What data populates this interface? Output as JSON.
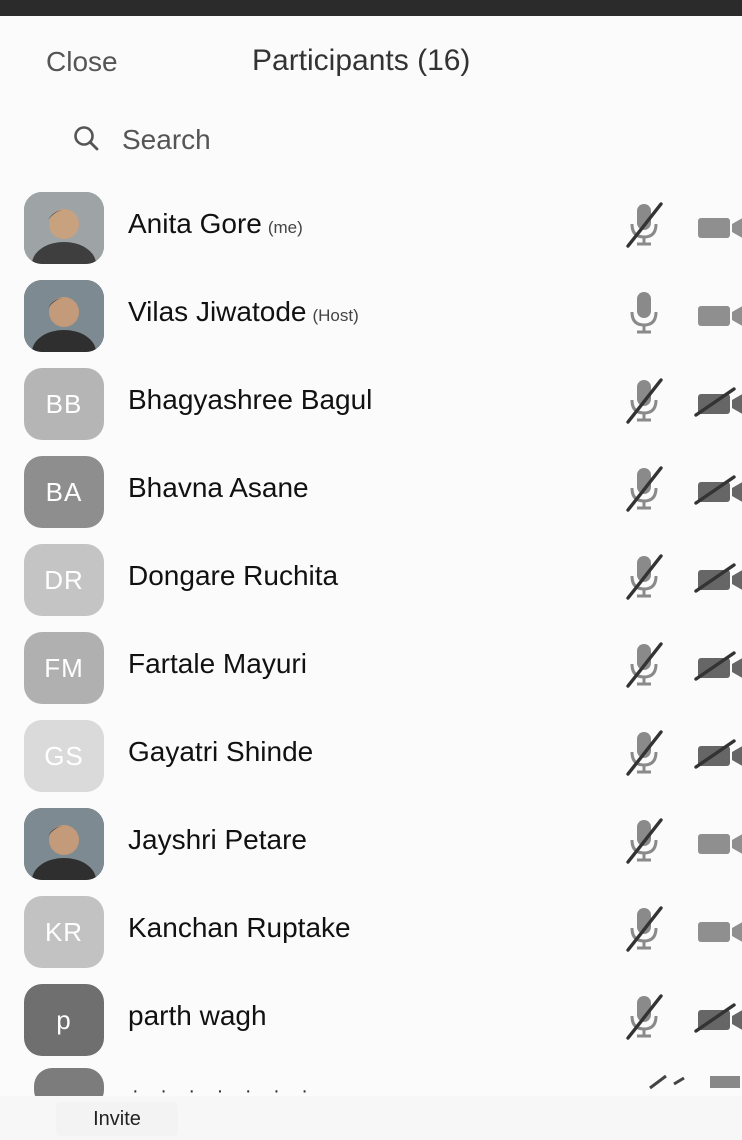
{
  "header": {
    "close_label": "Close",
    "title": "Participants (16)"
  },
  "search": {
    "placeholder": "Search",
    "icon": "search-icon"
  },
  "participants": [
    {
      "name": "Anita Gore",
      "tag": "(me)",
      "avatar": "photo",
      "mic": "muted",
      "video": "on"
    },
    {
      "name": "Vilas Jiwatode",
      "tag": "(Host)",
      "avatar": "photo",
      "mic": "on",
      "video": "on"
    },
    {
      "name": "Bhagyashree Bagul",
      "tag": "",
      "initials": "BB",
      "color": "#b5b5b5",
      "mic": "muted",
      "video": "off"
    },
    {
      "name": "Bhavna Asane",
      "tag": "",
      "initials": "BA",
      "color": "#8e8e8e",
      "mic": "muted",
      "video": "off"
    },
    {
      "name": "Dongare Ruchita",
      "tag": "",
      "initials": "DR",
      "color": "#c4c4c4",
      "mic": "muted",
      "video": "off"
    },
    {
      "name": "Fartale Mayuri",
      "tag": "",
      "initials": "FM",
      "color": "#b0b0b0",
      "mic": "muted",
      "video": "off"
    },
    {
      "name": "Gayatri Shinde",
      "tag": "",
      "initials": "GS",
      "color": "#dadada",
      "mic": "muted",
      "video": "off"
    },
    {
      "name": "Jayshri Petare",
      "tag": "",
      "avatar": "photo",
      "mic": "muted",
      "video": "on"
    },
    {
      "name": "Kanchan Ruptake",
      "tag": "",
      "initials": "KR",
      "color": "#c2c2c2",
      "mic": "muted",
      "video": "on"
    },
    {
      "name": "parth wagh",
      "tag": "",
      "initials": "p",
      "color": "#6f6f6f",
      "mic": "muted",
      "video": "off"
    }
  ],
  "footer": {
    "invite_label": "Invite"
  }
}
